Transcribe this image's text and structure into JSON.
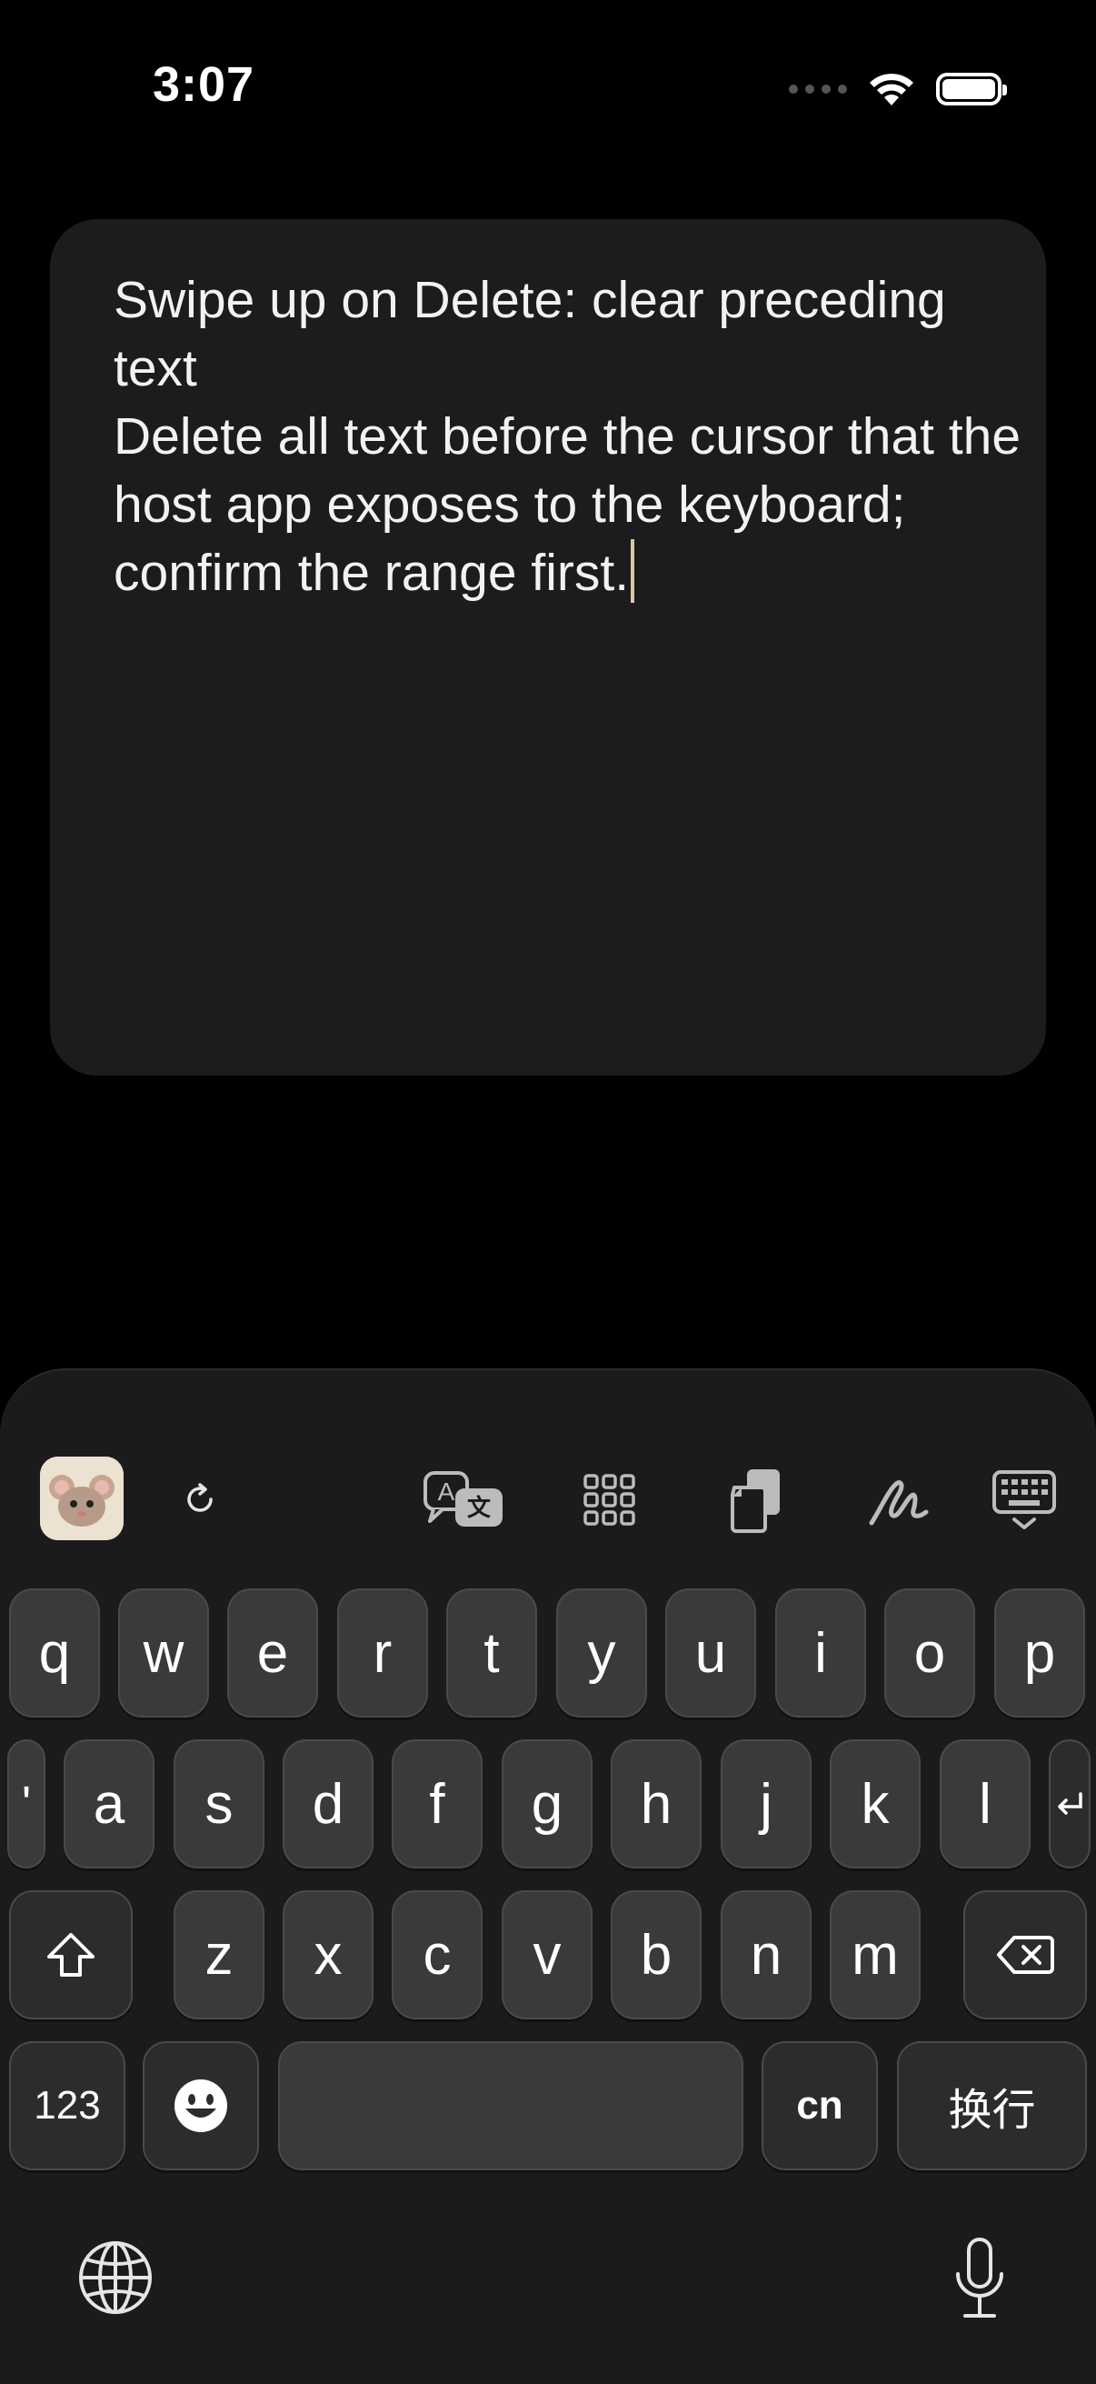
{
  "status_bar": {
    "time": "3:07"
  },
  "note": {
    "text": "Swipe up on Delete: clear preceding text\nDelete all text before the cursor that the host app exposes to the keyboard; confirm the range first."
  },
  "keyboard": {
    "toolbar": [
      "app-icon",
      "refresh-icon",
      "translate-icon",
      "grid-icon",
      "clipboard-icon",
      "handwriting-icon",
      "keyboard-hide-icon"
    ],
    "row1": [
      "q",
      "w",
      "e",
      "r",
      "t",
      "y",
      "u",
      "i",
      "o",
      "p"
    ],
    "row2": [
      "'",
      "a",
      "s",
      "d",
      "f",
      "g",
      "h",
      "j",
      "k",
      "l"
    ],
    "row3": [
      "z",
      "x",
      "c",
      "v",
      "b",
      "n",
      "m"
    ],
    "numbers_label": "123",
    "lang_label": "cn",
    "return_label": "换行",
    "space_label": ""
  }
}
